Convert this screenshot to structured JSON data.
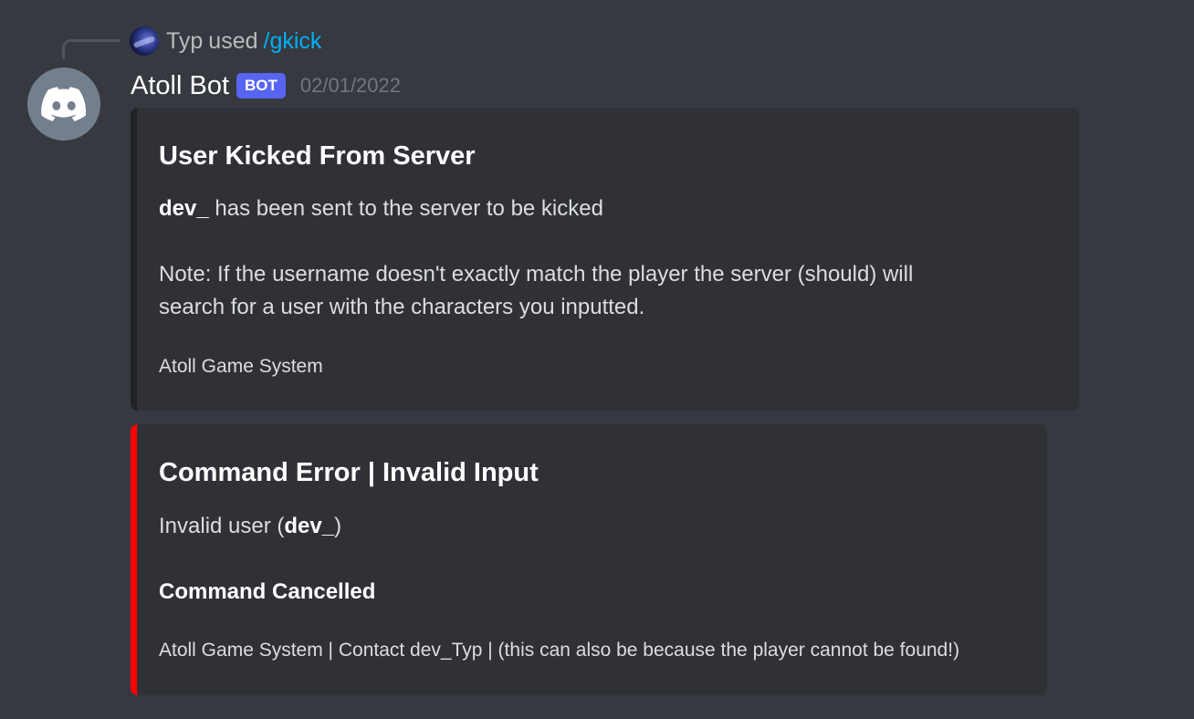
{
  "reply": {
    "user": "Typ",
    "used_text": "used",
    "command": "/gkick"
  },
  "message": {
    "author": "Atoll Bot",
    "badge": "BOT",
    "timestamp": "02/01/2022",
    "avatar_icon": "discord-logo-icon"
  },
  "embeds": [
    {
      "accent_color": "#202225",
      "title": "User Kicked From Server",
      "desc_user": "dev_",
      "desc_rest": " has been sent to the server to be kicked",
      "note_line1": "Note: If the username doesn't exactly match the player the server (should) will",
      "note_line2": "search for a user with the characters you inputted.",
      "footer": "Atoll Game System"
    },
    {
      "accent_color": "#ff0000",
      "title": "Command Error | Invalid Input",
      "desc_prefix": "Invalid user (",
      "desc_user": "dev_",
      "desc_suffix": ")",
      "status": "Command Cancelled",
      "footer": "Atoll Game System | Contact dev_Typ | (this can also be because the player cannot be found!)"
    }
  ],
  "colors": {
    "background": "#36393f",
    "embed_bg": "#2f3136",
    "link": "#00aff4",
    "bot_badge": "#5865f2",
    "error": "#ff0000"
  }
}
